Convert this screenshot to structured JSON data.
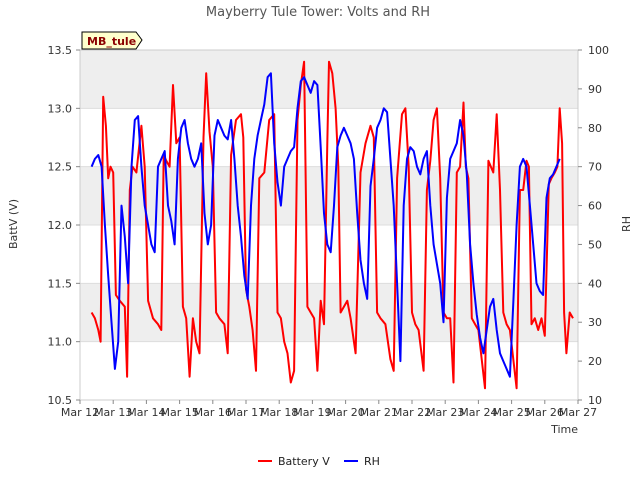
{
  "chart_data": {
    "type": "line",
    "title": "Mayberry Tule Tower: Volts and RH",
    "station_tag": "MB_tule",
    "xlabel": "Time",
    "ylabel_left": "BattV (V)",
    "ylabel_right": "RH",
    "x_ticks": [
      "Mar 12",
      "Mar 13",
      "Mar 14",
      "Mar 15",
      "Mar 16",
      "Mar 17",
      "Mar 18",
      "Mar 19",
      "Mar 20",
      "Mar 21",
      "Mar 22",
      "Mar 23",
      "Mar 24",
      "Mar 25",
      "Mar 26",
      "Mar 27"
    ],
    "xlim_days": [
      12,
      27
    ],
    "ylim_left": [
      10.5,
      13.5
    ],
    "ylim_right": [
      10,
      100
    ],
    "y_ticks_left": [
      "10.5",
      "11.0",
      "11.5",
      "12.0",
      "12.5",
      "13.0",
      "13.5"
    ],
    "y_ticks_right": [
      "10",
      "20",
      "30",
      "40",
      "50",
      "60",
      "70",
      "80",
      "90",
      "100"
    ],
    "grid_bands": true,
    "legend_position": "bottom-center",
    "series": [
      {
        "name": "Battery V",
        "axis": "left",
        "color": "#ff0000",
        "points": [
          [
            12.35,
            11.25
          ],
          [
            12.45,
            11.2
          ],
          [
            12.55,
            11.1
          ],
          [
            12.62,
            11.0
          ],
          [
            12.7,
            13.1
          ],
          [
            12.78,
            12.85
          ],
          [
            12.85,
            12.4
          ],
          [
            12.92,
            12.5
          ],
          [
            13.0,
            12.45
          ],
          [
            13.08,
            11.4
          ],
          [
            13.2,
            11.35
          ],
          [
            13.35,
            11.3
          ],
          [
            13.42,
            10.7
          ],
          [
            13.5,
            12.3
          ],
          [
            13.58,
            12.5
          ],
          [
            13.7,
            12.45
          ],
          [
            13.85,
            12.85
          ],
          [
            13.95,
            12.5
          ],
          [
            14.05,
            11.35
          ],
          [
            14.2,
            11.2
          ],
          [
            14.35,
            11.15
          ],
          [
            14.45,
            11.1
          ],
          [
            14.52,
            12.6
          ],
          [
            14.6,
            12.55
          ],
          [
            14.7,
            12.5
          ],
          [
            14.8,
            13.2
          ],
          [
            14.9,
            12.7
          ],
          [
            15.0,
            12.75
          ],
          [
            15.1,
            11.3
          ],
          [
            15.2,
            11.2
          ],
          [
            15.3,
            10.7
          ],
          [
            15.4,
            11.2
          ],
          [
            15.5,
            11.0
          ],
          [
            15.6,
            10.9
          ],
          [
            15.72,
            12.75
          ],
          [
            15.8,
            13.3
          ],
          [
            15.9,
            12.8
          ],
          [
            16.0,
            12.5
          ],
          [
            16.1,
            11.25
          ],
          [
            16.2,
            11.2
          ],
          [
            16.35,
            11.15
          ],
          [
            16.45,
            10.9
          ],
          [
            16.55,
            12.6
          ],
          [
            16.7,
            12.9
          ],
          [
            16.85,
            12.95
          ],
          [
            16.92,
            12.75
          ],
          [
            17.0,
            11.45
          ],
          [
            17.1,
            11.3
          ],
          [
            17.2,
            11.1
          ],
          [
            17.3,
            10.75
          ],
          [
            17.4,
            12.4
          ],
          [
            17.55,
            12.45
          ],
          [
            17.7,
            12.9
          ],
          [
            17.85,
            12.95
          ],
          [
            17.95,
            11.25
          ],
          [
            18.05,
            11.2
          ],
          [
            18.15,
            11.0
          ],
          [
            18.25,
            10.9
          ],
          [
            18.35,
            10.65
          ],
          [
            18.45,
            10.75
          ],
          [
            18.55,
            12.9
          ],
          [
            18.65,
            13.2
          ],
          [
            18.75,
            13.4
          ],
          [
            18.85,
            11.3
          ],
          [
            18.95,
            11.25
          ],
          [
            19.05,
            11.2
          ],
          [
            19.15,
            10.75
          ],
          [
            19.25,
            11.35
          ],
          [
            19.35,
            11.15
          ],
          [
            19.45,
            12.7
          ],
          [
            19.5,
            13.4
          ],
          [
            19.6,
            13.3
          ],
          [
            19.7,
            13.0
          ],
          [
            19.78,
            12.5
          ],
          [
            19.85,
            11.25
          ],
          [
            19.95,
            11.3
          ],
          [
            20.05,
            11.35
          ],
          [
            20.15,
            11.2
          ],
          [
            20.3,
            10.9
          ],
          [
            20.45,
            12.45
          ],
          [
            20.6,
            12.7
          ],
          [
            20.75,
            12.85
          ],
          [
            20.85,
            12.75
          ],
          [
            20.95,
            11.25
          ],
          [
            21.05,
            11.2
          ],
          [
            21.2,
            11.15
          ],
          [
            21.35,
            10.85
          ],
          [
            21.45,
            10.75
          ],
          [
            21.55,
            12.4
          ],
          [
            21.7,
            12.95
          ],
          [
            21.8,
            13.0
          ],
          [
            21.9,
            12.5
          ],
          [
            22.0,
            11.25
          ],
          [
            22.1,
            11.15
          ],
          [
            22.2,
            11.1
          ],
          [
            22.35,
            10.75
          ],
          [
            22.45,
            12.3
          ],
          [
            22.55,
            12.55
          ],
          [
            22.65,
            12.9
          ],
          [
            22.75,
            13.0
          ],
          [
            22.85,
            12.4
          ],
          [
            22.95,
            11.25
          ],
          [
            23.05,
            11.2
          ],
          [
            23.15,
            11.2
          ],
          [
            23.25,
            10.65
          ],
          [
            23.35,
            12.45
          ],
          [
            23.45,
            12.5
          ],
          [
            23.55,
            13.05
          ],
          [
            23.62,
            12.5
          ],
          [
            23.7,
            12.4
          ],
          [
            23.8,
            11.2
          ],
          [
            23.9,
            11.15
          ],
          [
            24.0,
            11.1
          ],
          [
            24.1,
            10.85
          ],
          [
            24.2,
            10.6
          ],
          [
            24.3,
            12.55
          ],
          [
            24.45,
            12.45
          ],
          [
            24.55,
            12.95
          ],
          [
            24.65,
            12.3
          ],
          [
            24.75,
            11.25
          ],
          [
            24.85,
            11.15
          ],
          [
            24.95,
            11.1
          ],
          [
            25.05,
            10.85
          ],
          [
            25.15,
            10.6
          ],
          [
            25.25,
            12.3
          ],
          [
            25.35,
            12.3
          ],
          [
            25.45,
            12.55
          ],
          [
            25.52,
            12.5
          ],
          [
            25.6,
            11.15
          ],
          [
            25.7,
            11.2
          ],
          [
            25.8,
            11.1
          ],
          [
            25.9,
            11.2
          ],
          [
            26.0,
            11.05
          ],
          [
            26.12,
            12.35
          ],
          [
            26.2,
            12.4
          ],
          [
            26.3,
            12.45
          ],
          [
            26.38,
            12.5
          ],
          [
            26.45,
            13.0
          ],
          [
            26.52,
            12.7
          ],
          [
            26.58,
            11.25
          ],
          [
            26.65,
            10.9
          ],
          [
            26.75,
            11.25
          ],
          [
            26.85,
            11.2
          ]
        ]
      },
      {
        "name": "RH",
        "axis": "right",
        "color": "#0000ff",
        "points": [
          [
            12.35,
            70
          ],
          [
            12.45,
            72
          ],
          [
            12.55,
            73
          ],
          [
            12.65,
            70
          ],
          [
            12.75,
            55
          ],
          [
            12.85,
            42
          ],
          [
            12.95,
            30
          ],
          [
            13.05,
            18
          ],
          [
            13.15,
            25
          ],
          [
            13.25,
            60
          ],
          [
            13.35,
            52
          ],
          [
            13.45,
            40
          ],
          [
            13.55,
            70
          ],
          [
            13.65,
            82
          ],
          [
            13.75,
            83
          ],
          [
            13.85,
            70
          ],
          [
            13.95,
            60
          ],
          [
            14.05,
            55
          ],
          [
            14.15,
            50
          ],
          [
            14.25,
            48
          ],
          [
            14.35,
            70
          ],
          [
            14.45,
            72
          ],
          [
            14.55,
            74
          ],
          [
            14.65,
            60
          ],
          [
            14.75,
            56
          ],
          [
            14.85,
            50
          ],
          [
            14.95,
            72
          ],
          [
            15.05,
            80
          ],
          [
            15.15,
            82
          ],
          [
            15.25,
            76
          ],
          [
            15.35,
            72
          ],
          [
            15.45,
            70
          ],
          [
            15.55,
            72
          ],
          [
            15.65,
            76
          ],
          [
            15.75,
            58
          ],
          [
            15.85,
            50
          ],
          [
            15.95,
            55
          ],
          [
            16.05,
            78
          ],
          [
            16.15,
            82
          ],
          [
            16.25,
            80
          ],
          [
            16.35,
            78
          ],
          [
            16.45,
            77
          ],
          [
            16.55,
            82
          ],
          [
            16.65,
            72
          ],
          [
            16.75,
            60
          ],
          [
            16.85,
            52
          ],
          [
            16.95,
            42
          ],
          [
            17.05,
            36
          ],
          [
            17.15,
            60
          ],
          [
            17.25,
            72
          ],
          [
            17.35,
            78
          ],
          [
            17.45,
            82
          ],
          [
            17.55,
            86
          ],
          [
            17.65,
            93
          ],
          [
            17.75,
            94
          ],
          [
            17.85,
            76
          ],
          [
            17.95,
            66
          ],
          [
            18.05,
            60
          ],
          [
            18.15,
            70
          ],
          [
            18.25,
            72
          ],
          [
            18.35,
            74
          ],
          [
            18.45,
            75
          ],
          [
            18.55,
            85
          ],
          [
            18.65,
            92
          ],
          [
            18.75,
            93
          ],
          [
            18.85,
            91
          ],
          [
            18.95,
            89
          ],
          [
            19.05,
            92
          ],
          [
            19.15,
            91
          ],
          [
            19.25,
            75
          ],
          [
            19.35,
            58
          ],
          [
            19.45,
            50
          ],
          [
            19.55,
            48
          ],
          [
            19.65,
            60
          ],
          [
            19.75,
            75
          ],
          [
            19.85,
            78
          ],
          [
            19.95,
            80
          ],
          [
            20.05,
            78
          ],
          [
            20.15,
            76
          ],
          [
            20.25,
            72
          ],
          [
            20.35,
            58
          ],
          [
            20.45,
            46
          ],
          [
            20.55,
            40
          ],
          [
            20.65,
            36
          ],
          [
            20.75,
            65
          ],
          [
            20.85,
            72
          ],
          [
            20.95,
            80
          ],
          [
            21.05,
            82
          ],
          [
            21.15,
            85
          ],
          [
            21.25,
            84
          ],
          [
            21.35,
            72
          ],
          [
            21.45,
            60
          ],
          [
            21.55,
            40
          ],
          [
            21.65,
            20
          ],
          [
            21.75,
            60
          ],
          [
            21.85,
            72
          ],
          [
            21.95,
            75
          ],
          [
            22.05,
            74
          ],
          [
            22.15,
            70
          ],
          [
            22.25,
            68
          ],
          [
            22.35,
            72
          ],
          [
            22.45,
            74
          ],
          [
            22.55,
            60
          ],
          [
            22.65,
            50
          ],
          [
            22.75,
            45
          ],
          [
            22.85,
            40
          ],
          [
            22.95,
            30
          ],
          [
            23.05,
            62
          ],
          [
            23.15,
            72
          ],
          [
            23.25,
            74
          ],
          [
            23.35,
            76
          ],
          [
            23.45,
            82
          ],
          [
            23.55,
            78
          ],
          [
            23.65,
            68
          ],
          [
            23.75,
            50
          ],
          [
            23.85,
            40
          ],
          [
            23.95,
            32
          ],
          [
            24.05,
            26
          ],
          [
            24.15,
            22
          ],
          [
            24.25,
            28
          ],
          [
            24.35,
            34
          ],
          [
            24.45,
            36
          ],
          [
            24.55,
            28
          ],
          [
            24.65,
            22
          ],
          [
            24.75,
            20
          ],
          [
            24.85,
            18
          ],
          [
            24.95,
            16
          ],
          [
            25.05,
            35
          ],
          [
            25.15,
            55
          ],
          [
            25.25,
            70
          ],
          [
            25.35,
            72
          ],
          [
            25.45,
            70
          ],
          [
            25.55,
            60
          ],
          [
            25.65,
            50
          ],
          [
            25.75,
            40
          ],
          [
            25.85,
            38
          ],
          [
            25.95,
            37
          ],
          [
            26.05,
            62
          ],
          [
            26.15,
            67
          ],
          [
            26.25,
            68
          ],
          [
            26.35,
            70
          ],
          [
            26.45,
            72
          ]
        ]
      }
    ]
  }
}
